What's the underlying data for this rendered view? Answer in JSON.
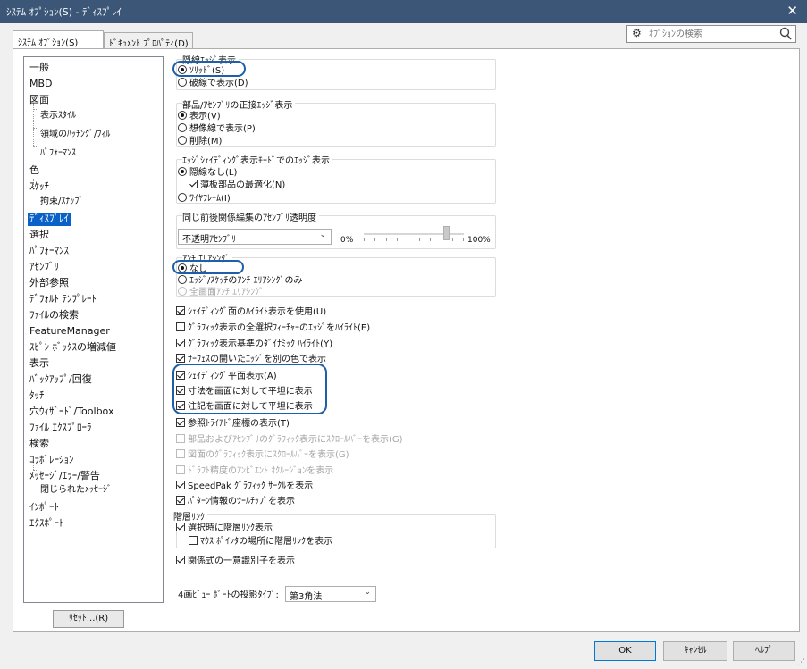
{
  "window": {
    "title": "ｼｽﾃﾑ ｵﾌﾟｼｮﾝ(S) - ﾃﾞｨｽﾌﾟﾚｲ",
    "close_glyph": "✕"
  },
  "tabs": [
    {
      "label": "ｼｽﾃﾑ ｵﾌﾟｼｮﾝ(S)",
      "active": true
    },
    {
      "label": "ﾄﾞｷｭﾒﾝﾄ ﾌﾟﾛﾊﾟﾃｨ(D)",
      "active": false
    }
  ],
  "search": {
    "placeholder": "ｵﾌﾟｼｮﾝの検索",
    "icon": "gear-icon"
  },
  "tree": {
    "items": [
      {
        "label": "一般"
      },
      {
        "label": "MBD"
      },
      {
        "label": "図面"
      },
      {
        "label": "表示ｽﾀｲﾙ",
        "child": true
      },
      {
        "label": "領域のﾊｯﾁﾝｸﾞ/ﾌｨﾙ",
        "child": true
      },
      {
        "label": "ﾊﾟﾌｫｰﾏﾝｽ",
        "child": true
      },
      {
        "label": "色"
      },
      {
        "label": "ｽｹｯﾁ"
      },
      {
        "label": "拘束/ｽﾅｯﾌﾟ",
        "child": true
      },
      {
        "label": "ﾃﾞｨｽﾌﾟﾚｲ",
        "selected": true
      },
      {
        "label": "選択"
      },
      {
        "label": "ﾊﾟﾌｫｰﾏﾝｽ"
      },
      {
        "label": "ｱｾﾝﾌﾞﾘ"
      },
      {
        "label": "外部参照"
      },
      {
        "label": "ﾃﾞﾌｫﾙﾄ ﾃﾝﾌﾟﾚｰﾄ"
      },
      {
        "label": "ﾌｧｲﾙの検索"
      },
      {
        "label": "FeatureManager"
      },
      {
        "label": "ｽﾋﾟﾝ ﾎﾞｯｸｽの増減値"
      },
      {
        "label": "表示"
      },
      {
        "label": "ﾊﾞｯｸｱｯﾌﾟ/回復"
      },
      {
        "label": "ﾀｯﾁ"
      },
      {
        "label": "穴ｳｨｻﾞｰﾄﾞ/Toolbox"
      },
      {
        "label": "ﾌｧｲﾙ ｴｸｽﾌﾟﾛｰﾗ"
      },
      {
        "label": "検索"
      },
      {
        "label": "ｺﾗﾎﾞﾚｰｼｮﾝ"
      },
      {
        "label": "ﾒｯｾｰｼﾞ/ｴﾗｰ/警告"
      },
      {
        "label": "閉じられたﾒｯｾｰｼﾞ",
        "child": true
      },
      {
        "label": "ｲﾝﾎﾟｰﾄ"
      },
      {
        "label": "ｴｸｽﾎﾟｰﾄ"
      }
    ],
    "reset_label": "ﾘｾｯﾄ...(R)"
  },
  "groups": {
    "hidden_edges": {
      "title": "隠線ｴｯｼﾞ表示",
      "options": [
        {
          "label": "ｿﾘｯﾄﾞ(S)",
          "checked": true
        },
        {
          "label": "破線で表示(D)",
          "checked": false
        }
      ]
    },
    "tangent_edges": {
      "title": "部品/ｱｾﾝﾌﾞﾘの正接ｴｯｼﾞ表示",
      "options": [
        {
          "label": "表示(V)",
          "checked": true
        },
        {
          "label": "想像線で表示(P)",
          "checked": false
        },
        {
          "label": "削除(M)",
          "checked": false
        }
      ]
    },
    "shaded_edges": {
      "title": "ｴｯｼﾞｼｪｲﾃﾞｨﾝｸﾞ表示ﾓｰﾄﾞでのｴｯｼﾞ表示",
      "opt1": "隠線なし(L)",
      "sub_check": "薄板部品の最適化(N)",
      "opt2": "ﾜｲﾔﾌﾚｰﾑ(I)"
    },
    "transparency": {
      "title": "同じ前後関係編集のｱｾﾝﾌﾞﾘ透明度",
      "combo_value": "不透明ｱｾﾝﾌﾞﾘ",
      "min_label": "0%",
      "max_label": "100%",
      "slider_value_percent": 82
    },
    "antialias": {
      "title": "ｱﾝﾁ ｴﾘｱｼﾝｸﾞ",
      "options": [
        {
          "label": "なし",
          "checked": true,
          "disabled": false
        },
        {
          "label": "ｴｯｼﾞ/ｽｹｯﾁのｱﾝﾁ ｴﾘｱｼﾝｸﾞのみ",
          "checked": false,
          "disabled": false
        },
        {
          "label": "全画面ｱﾝﾁ ｴﾘｱｼﾝｸﾞ",
          "checked": false,
          "disabled": true
        }
      ]
    }
  },
  "checks": [
    {
      "label": "ｼｪｲﾃﾞｨﾝｸﾞ面のﾊｲﾗｲﾄ表示を使用(U)",
      "checked": true,
      "disabled": false
    },
    {
      "label": "ｸﾞﾗﾌｨｯｸ表示の全選択ﾌｨｰﾁｬｰのｴｯｼﾞをﾊｲﾗｲﾄ(E)",
      "checked": false,
      "disabled": false
    },
    {
      "label": "ｸﾞﾗﾌｨｯｸ表示基準のﾀﾞｲﾅﾐｯｸ ﾊｲﾗｲﾄ(Y)",
      "checked": true,
      "disabled": false
    },
    {
      "label": "ｻｰﾌｪｽの開いたｴｯｼﾞを別の色で表示",
      "checked": true,
      "disabled": false
    },
    {
      "label": "ｼｪｲﾃﾞｨﾝｸﾞ平面表示(A)",
      "checked": true,
      "disabled": false
    },
    {
      "label": "寸法を画面に対して平坦に表示",
      "checked": true,
      "disabled": false
    },
    {
      "label": "注記を画面に対して平坦に表示",
      "checked": true,
      "disabled": false
    },
    {
      "label": "参照ﾄﾗｲｱﾄﾞ座標の表示(T)",
      "checked": true,
      "disabled": false
    },
    {
      "label": "部品およびｱｾﾝﾌﾞﾘのｸﾞﾗﾌｨｯｸ表示にｽｸﾛｰﾙﾊﾞｰを表示(G)",
      "checked": false,
      "disabled": true
    },
    {
      "label": "図面のｸﾞﾗﾌｨｯｸ表示にｽｸﾛｰﾙﾊﾞｰを表示(G)",
      "checked": false,
      "disabled": true
    },
    {
      "label": "ﾄﾞﾗﾌﾄ精度のｱﾝﾋﾞｴﾝﾄ ｵｸﾙｰｼﾞｮﾝを表示",
      "checked": false,
      "disabled": true
    },
    {
      "label": "SpeedPak ｸﾞﾗﾌｨｯｸ ｻｰｸﾙを表示",
      "checked": true,
      "disabled": false
    },
    {
      "label": "ﾊﾟﾀｰﾝ情報のﾂｰﾙﾁｯﾌﾟを表示",
      "checked": true,
      "disabled": false
    }
  ],
  "breadcrumb_group": {
    "title": "階層ﾘﾝｸ",
    "check1": {
      "label": "選択時に階層ﾘﾝｸ表示",
      "checked": true
    },
    "check2": {
      "label": "ﾏｳｽ ﾎﾟｲﾝﾀの場所に階層ﾘﾝｸを表示",
      "checked": false
    }
  },
  "unique_id_check": {
    "label": "関係式の一意識別子を表示",
    "checked": true
  },
  "projection": {
    "label": "4画ﾋﾞｭｰ ﾎﾟｰﾄの投影ﾀｲﾌﾟ:",
    "value": "第3角法"
  },
  "footer": {
    "ok": "OK",
    "cancel": "ｷｬﾝｾﾙ",
    "help": "ﾍﾙﾌﾟ"
  },
  "colors": {
    "accent": "#1d5fa8",
    "titlebar": "#3b5677",
    "selection": "#0a62c9"
  }
}
